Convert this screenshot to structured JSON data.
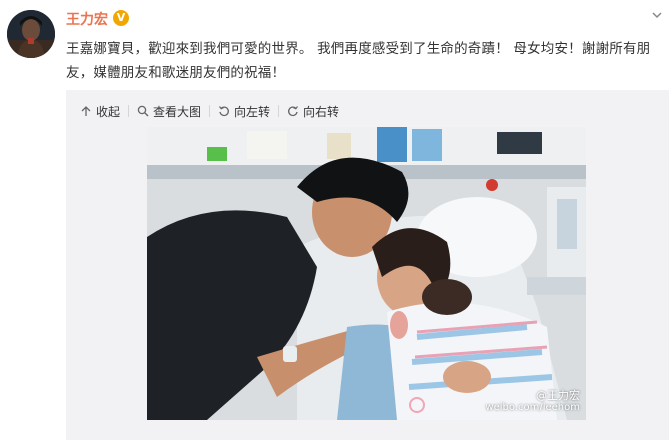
{
  "user": {
    "name": "王力宏",
    "badge": "V",
    "avatar_icon": "avatar-portrait-icon"
  },
  "post": {
    "text_line1": "王嘉娜寶貝，歡迎來到我們可愛的世界。 我們再度感受到了生命的奇蹟！ 母女均安！謝謝所有朋",
    "text_line2": "友，媒體朋友和歌迷朋友們的祝福！"
  },
  "toolbar": {
    "collapse_label": "收起",
    "view_large_label": "查看大图",
    "rotate_left_label": "向左转",
    "rotate_right_label": "向右转"
  },
  "watermark": {
    "name": "@王力宏",
    "url": "weibo.com/leehom"
  },
  "colors": {
    "username": "#eb7350",
    "badge": "#f2a600",
    "media_bg": "#f2f2f5"
  }
}
